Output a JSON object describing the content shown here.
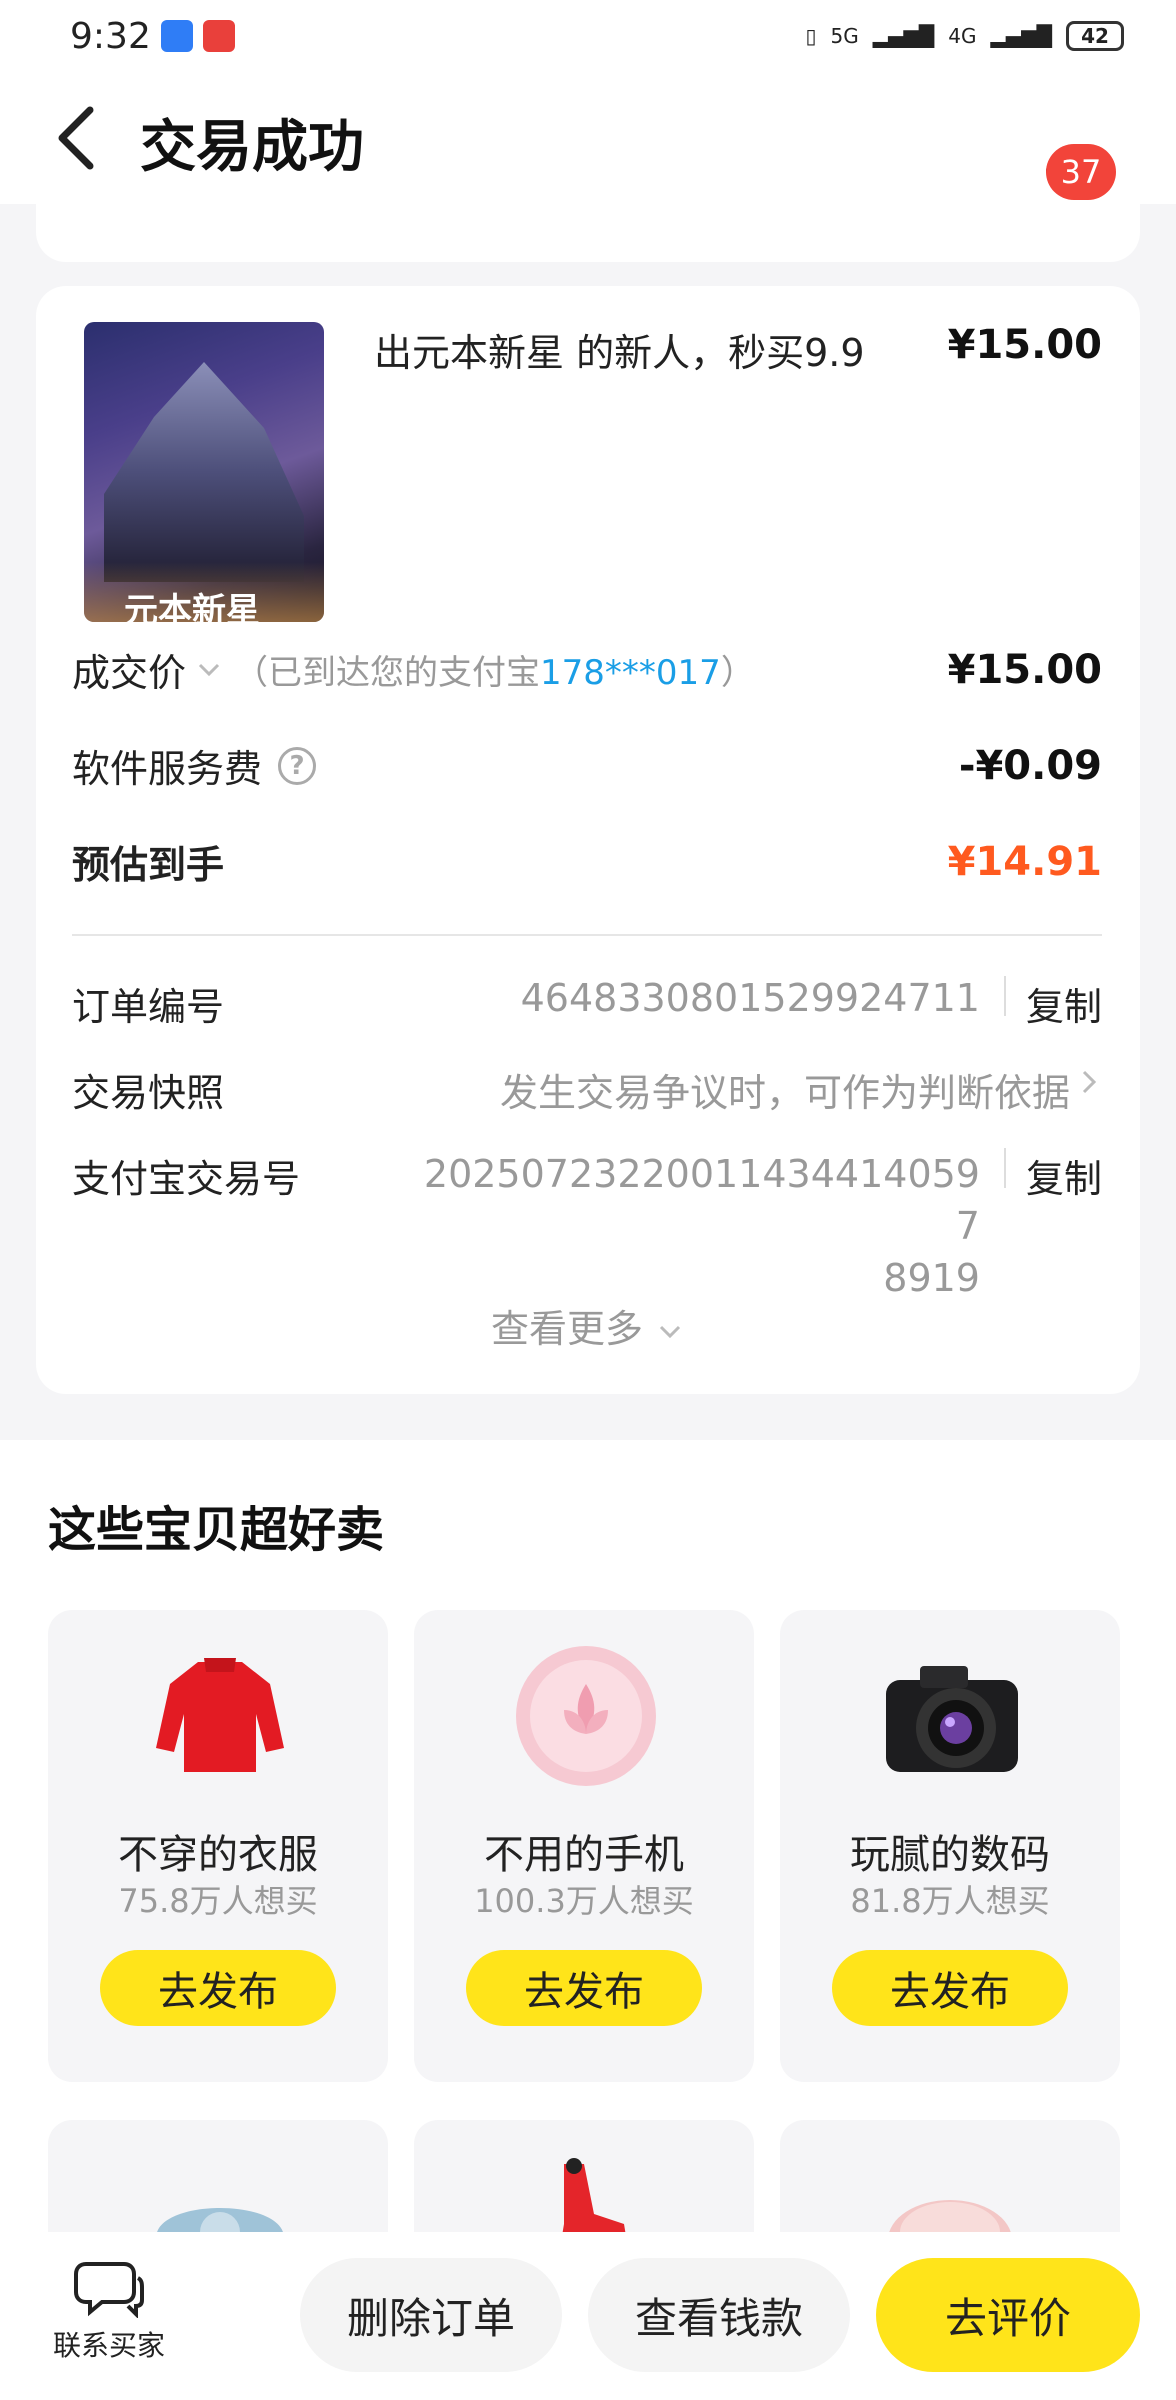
{
  "status": {
    "time": "9:32",
    "battery": "42",
    "net1": "5G",
    "net2": "4G"
  },
  "header": {
    "title": "交易成功",
    "badge": "37"
  },
  "item": {
    "title": "出元本新星 的新人，秒买9.9",
    "price": "¥15.00",
    "thumb_caption": "元本新星"
  },
  "price_rows": {
    "deal_label": "成交价",
    "deal_note_prefix": "（已到达您的支付宝",
    "deal_note_account": "178***017",
    "deal_note_suffix": "）",
    "deal_value": "¥15.00",
    "fee_label": "软件服务费",
    "fee_value": "-¥0.09",
    "net_label": "预估到手",
    "net_value": "¥14.91",
    "accent": "#ff5a1f"
  },
  "order": {
    "order_no_label": "订单编号",
    "order_no_value": "4648330801529924711",
    "copy_label": "复制",
    "snapshot_label": "交易快照",
    "snapshot_value": "发生交易争议时，可作为判断依据",
    "alipay_label": "支付宝交易号",
    "alipay_value_line1": "20250723220011434414059​7",
    "alipay_value_line2": "8919",
    "see_more": "查看更多"
  },
  "recommend": {
    "title": "这些宝贝超好卖",
    "tiles": [
      {
        "name": "不穿的衣服",
        "want": "75.8万人想买",
        "button": "去发布"
      },
      {
        "name": "不用的手机",
        "want": "100.3万人想买",
        "button": "去发布"
      },
      {
        "name": "玩腻的数码",
        "want": "81.8万人想买",
        "button": "去发布"
      }
    ]
  },
  "bottom": {
    "contact": "联系买家",
    "delete": "删除订单",
    "money": "查看钱款",
    "review": "去评价",
    "accent": "#ffe41a"
  }
}
